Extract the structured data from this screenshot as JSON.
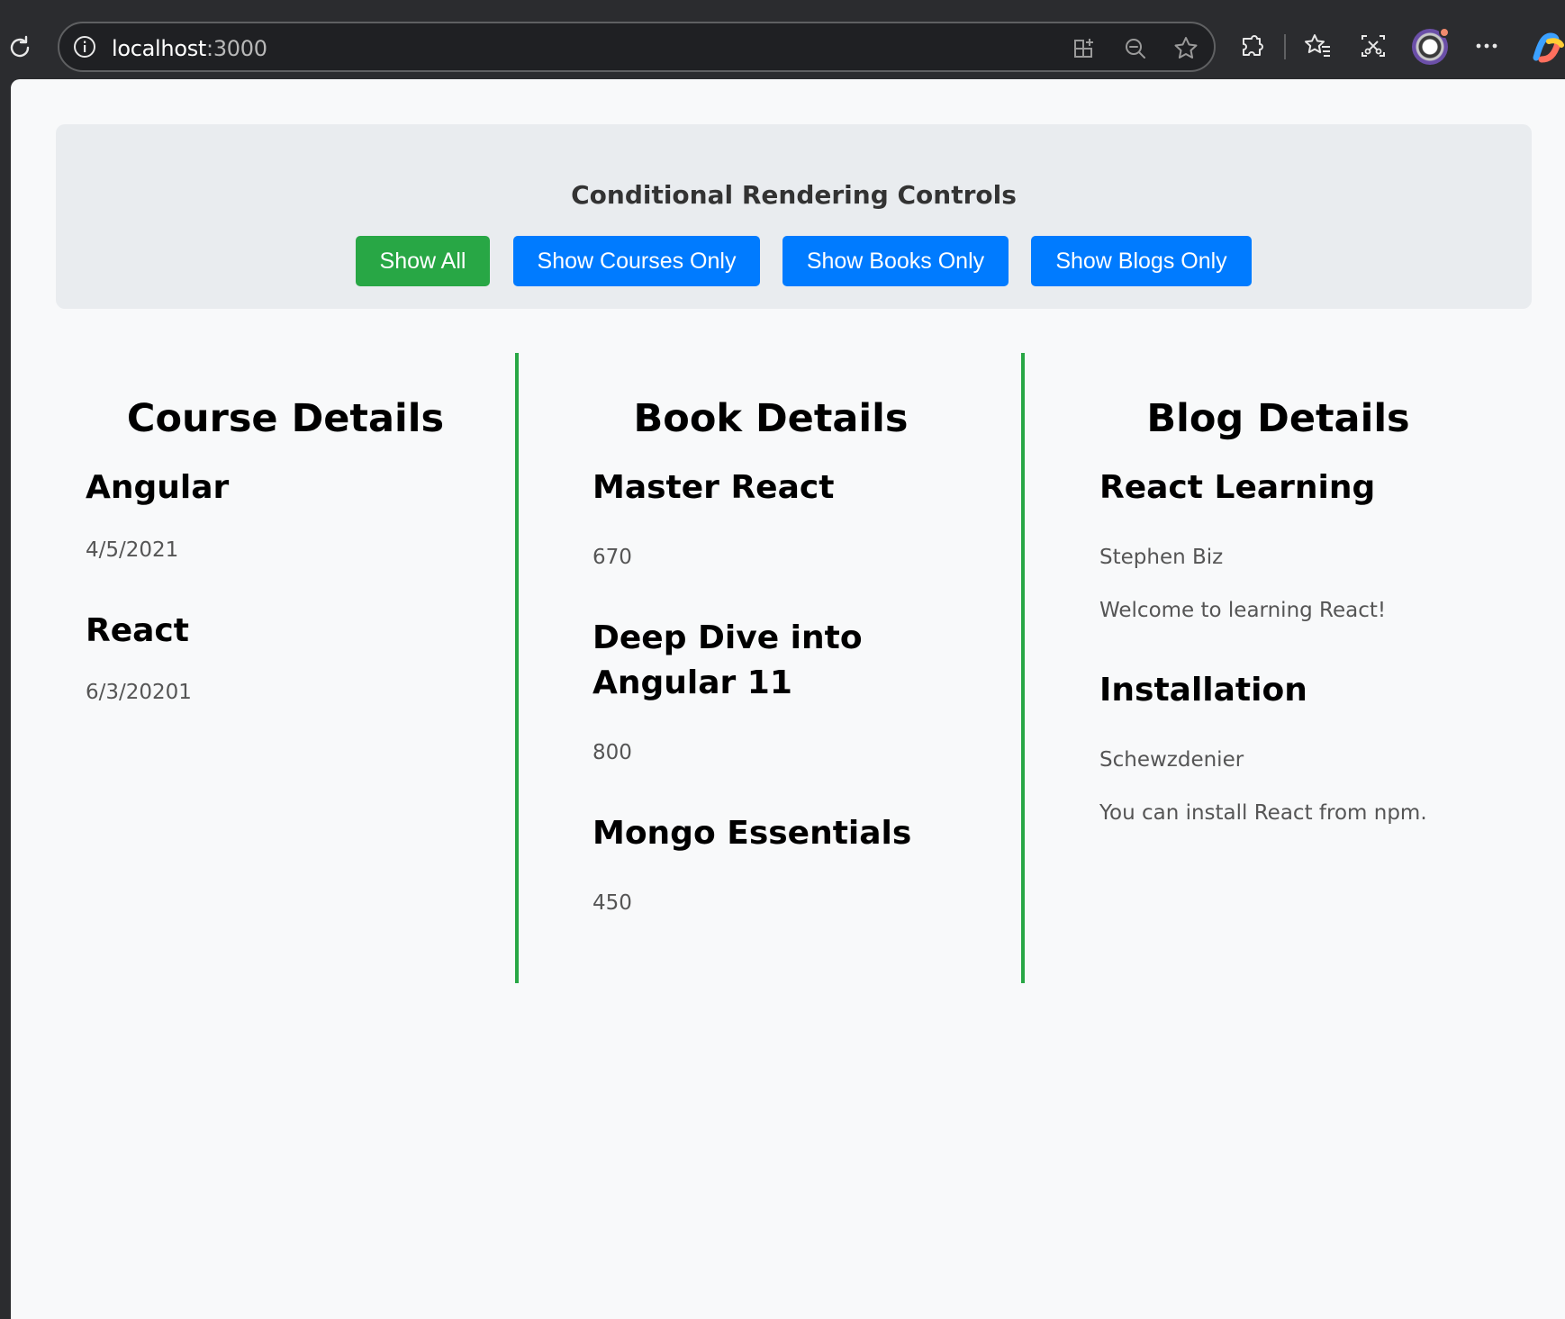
{
  "browser": {
    "url_host": "localhost",
    "url_port": ":3000"
  },
  "controls": {
    "title": "Conditional Rendering Controls",
    "buttons": [
      {
        "label": "Show All",
        "active": true
      },
      {
        "label": "Show Courses Only",
        "active": false
      },
      {
        "label": "Show Books Only",
        "active": false
      },
      {
        "label": "Show Blogs Only",
        "active": false
      }
    ]
  },
  "courses": {
    "title": "Course Details",
    "items": [
      {
        "name": "Angular",
        "date": "4/5/2021"
      },
      {
        "name": "React",
        "date": "6/3/20201"
      }
    ]
  },
  "books": {
    "title": "Book Details",
    "items": [
      {
        "name": "Master React",
        "price": "670"
      },
      {
        "name": "Deep Dive into Angular 11",
        "price": "800"
      },
      {
        "name": "Mongo Essentials",
        "price": "450"
      }
    ]
  },
  "blogs": {
    "title": "Blog Details",
    "items": [
      {
        "title": "React Learning",
        "author": "Stephen Biz",
        "content": "Welcome to learning React!"
      },
      {
        "title": "Installation",
        "author": "Schewzdenier",
        "content": "You can install React from npm."
      }
    ]
  },
  "colors": {
    "active_button": "#28a745",
    "inactive_button": "#007bff",
    "divider": "#28a745",
    "controls_bg": "#e9ecef",
    "page_bg": "#f8f9fa"
  }
}
